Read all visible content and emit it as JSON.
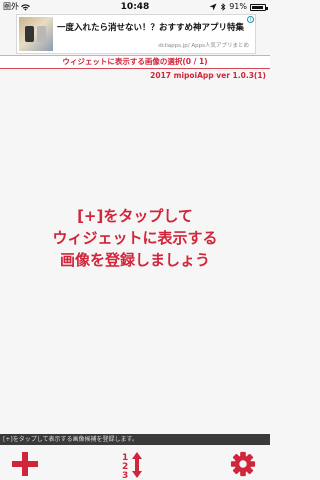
{
  "status_bar": {
    "carrier": "圏外",
    "time": "10:48",
    "battery_percent": "91%",
    "battery_level": 0.91
  },
  "ad": {
    "title": "一度入れたら消せない！？おすすめ神アプリ特集",
    "source": "dcliapps.jp/ Apps人気アプリまとめ",
    "badge": "i"
  },
  "header": {
    "selection_label": "ウィジェットに表示する画像の選択(0 / 1)",
    "version": "2017 mipoiApp ver 1.0.3(1)"
  },
  "instructions": {
    "line1": "[+]をタップして",
    "line2": "ウィジェットに表示する",
    "line3": "画像を登録しましょう"
  },
  "bottom_hint": "[+]をタップして表示する画像候補を登録します。",
  "toolbar": {
    "add_icon": "plus-icon",
    "sort_icon": "sort-123-icon",
    "settings_icon": "gear-icon"
  },
  "colors": {
    "accent": "#d0253a",
    "background": "#f6f6f6",
    "hint_bar": "#3a3a3a"
  }
}
